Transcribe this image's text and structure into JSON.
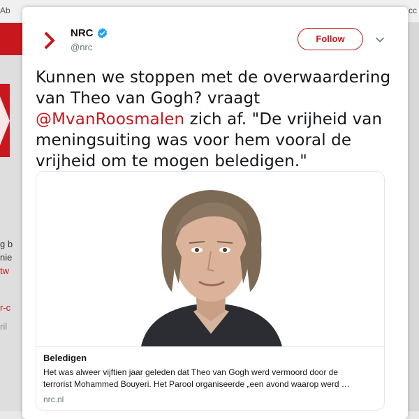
{
  "background": {
    "top_fragments": [
      "Ab",
      "cc"
    ],
    "left_fragments": [
      "g b",
      "nie",
      "tw",
      "r-c",
      "ril"
    ]
  },
  "tweet": {
    "author": {
      "name": "NRC",
      "handle": "@nrc",
      "verified": true,
      "avatar_icon": "nrc-logo-icon"
    },
    "follow_label": "Follow",
    "menu_icon": "chevron-down-icon",
    "text_before": "Kunnen we stoppen met de overwaardering van Theo van Gogh? vraagt ",
    "mention": "@MvanRoosmalen",
    "text_after": " zich af. \"De vrijheid van meningsuiting was voor hem vooral de vrijheid om te mogen beledigen.\"",
    "card": {
      "title": "Beledigen",
      "description_line1": "Het was alweer vijftien jaar geleden dat Theo van Gogh werd vermoord door de",
      "description_line2": "terrorist Mohammed Bouyeri. Het Parool organiseerde „een avond waarop werd …",
      "domain": "nrc.nl"
    }
  },
  "colors": {
    "brand_red": "#c8181d",
    "verified_blue": "#1da1f2",
    "text": "#14171a",
    "muted": "#657786"
  }
}
